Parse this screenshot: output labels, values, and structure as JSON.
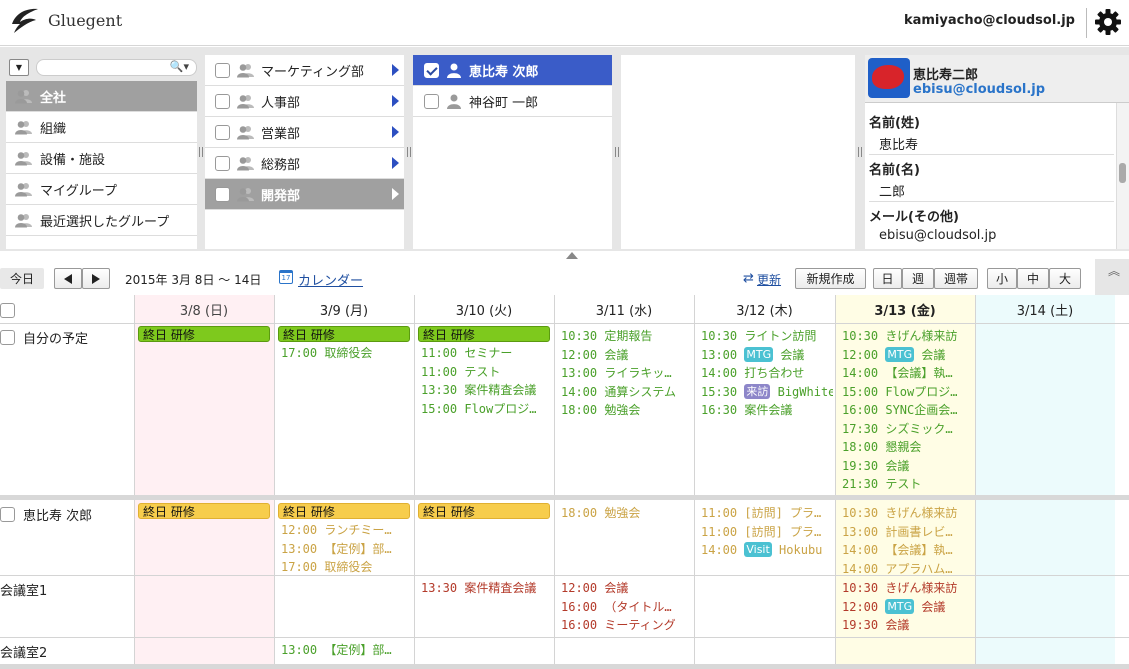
{
  "header": {
    "app_name": "Gluegent",
    "user_email": "kamiyacho@cloudsol.jp"
  },
  "pane1": {
    "dropdown_glyph": "▼",
    "search_placeholder": "",
    "search_icon": "🔍▾",
    "items": [
      {
        "label": "全社",
        "selected": true
      },
      {
        "label": "組織",
        "selected": false
      },
      {
        "label": "設備・施設",
        "selected": false
      },
      {
        "label": "マイグループ",
        "selected": false
      },
      {
        "label": "最近選択したグループ",
        "selected": false
      }
    ]
  },
  "pane2": {
    "items": [
      {
        "label": "マーケティング部",
        "selected": false
      },
      {
        "label": "人事部",
        "selected": false
      },
      {
        "label": "営業部",
        "selected": false
      },
      {
        "label": "総務部",
        "selected": false
      },
      {
        "label": "開発部",
        "selected": true
      }
    ]
  },
  "pane3": {
    "items": [
      {
        "label": "恵比寿 次郎",
        "selected": true,
        "checked": true
      },
      {
        "label": "神谷町 一郎",
        "selected": false,
        "checked": false
      }
    ]
  },
  "detail": {
    "name": "恵比寿二郎",
    "email": "ebisu@cloudsol.jp",
    "fields": [
      {
        "label": "名前(姓)",
        "value": "恵比寿"
      },
      {
        "label": "名前(名)",
        "value": "二郎"
      },
      {
        "label": "メール(その他)",
        "value": "ebisu@cloudsol.jp"
      }
    ]
  },
  "toolbar": {
    "today": "今日",
    "range": "2015年 3月 8日 〜 14日",
    "calendar_icon_text": "17",
    "calendar_link": "カレンダー",
    "refresh_icon": "⇄",
    "refresh": "更新",
    "new": "新規作成",
    "views": [
      "日",
      "週",
      "週帯"
    ],
    "sizes": [
      "小",
      "中",
      "大"
    ],
    "collapse_glyph": "︽"
  },
  "calendar": {
    "colors": {
      "sunday_bg": "#fff0f3",
      "today_bg": "#fffde5",
      "saturday_bg": "#ecfbfc",
      "event_green": "#4aa02a",
      "event_yellow": "#caa345",
      "event_red": "#b33a2a",
      "allday_green": "#7ec91d",
      "allday_yellow": "#f7cd4c"
    },
    "days": [
      {
        "label": "3/8 (日)",
        "type": "sun"
      },
      {
        "label": "3/9 (月)",
        "type": "weekday"
      },
      {
        "label": "3/10 (火)",
        "type": "weekday"
      },
      {
        "label": "3/11 (水)",
        "type": "weekday"
      },
      {
        "label": "3/12 (木)",
        "type": "weekday"
      },
      {
        "label": "3/13 (金)",
        "type": "today"
      },
      {
        "label": "3/14 (土)",
        "type": "sat"
      }
    ],
    "rows": [
      {
        "label": "自分の予定",
        "checkbox": true,
        "color": "green",
        "cells": [
          {
            "allday": "終日 研修",
            "events": []
          },
          {
            "allday": "終日 研修",
            "events": [
              {
                "time": "17:00",
                "title": "取締役会"
              }
            ]
          },
          {
            "allday": "終日 研修",
            "events": [
              {
                "time": "11:00",
                "title": "セミナー"
              },
              {
                "time": "11:00",
                "title": "テスト"
              },
              {
                "time": "13:30",
                "title": "案件精査会議"
              },
              {
                "time": "15:00",
                "title": "Flowプロジ…"
              }
            ]
          },
          {
            "allday": "",
            "events": [
              {
                "time": "10:30",
                "title": "定期報告"
              },
              {
                "time": "12:00",
                "title": "会議"
              },
              {
                "time": "13:00",
                "title": "ライラキッ…"
              },
              {
                "time": "14:00",
                "title": "通算システム"
              },
              {
                "time": "18:00",
                "title": "勉強会"
              }
            ]
          },
          {
            "allday": "",
            "events": [
              {
                "time": "10:30",
                "title": "ライトン訪問"
              },
              {
                "time": "13:00",
                "badge": "MTG",
                "badge_color": "teal",
                "title": "会議"
              },
              {
                "time": "14:00",
                "title": "打ち合わせ"
              },
              {
                "time": "15:30",
                "badge": "来訪",
                "badge_color": "purple",
                "title": "BigWhite"
              },
              {
                "time": "16:30",
                "title": "案件会議"
              }
            ]
          },
          {
            "allday": "",
            "events": [
              {
                "time": "10:30",
                "title": "きげん様来訪"
              },
              {
                "time": "12:00",
                "badge": "MTG",
                "badge_color": "teal",
                "title": "会議"
              },
              {
                "time": "14:00",
                "title": "【会議】執…"
              },
              {
                "time": "15:00",
                "title": "Flowプロジ…"
              },
              {
                "time": "16:00",
                "title": "SYNC企画会…"
              },
              {
                "time": "17:30",
                "title": "シズミック…"
              },
              {
                "time": "18:00",
                "title": "懇親会"
              },
              {
                "time": "19:30",
                "title": "会議"
              },
              {
                "time": "21:30",
                "title": "テスト"
              }
            ]
          },
          {
            "allday": "",
            "events": []
          }
        ]
      },
      {
        "label": "恵比寿 次郎",
        "checkbox": true,
        "color": "yellow",
        "cells": [
          {
            "allday": "終日 研修",
            "events": []
          },
          {
            "allday": "終日 研修",
            "events": [
              {
                "time": "12:00",
                "title": "ランチミー…"
              },
              {
                "time": "13:00",
                "title": "【定例】部…"
              },
              {
                "time": "17:00",
                "title": "取締役会"
              }
            ]
          },
          {
            "allday": "終日 研修",
            "events": []
          },
          {
            "allday": "",
            "events": [
              {
                "time": "18:00",
                "title": "勉強会"
              }
            ]
          },
          {
            "allday": "",
            "events": [
              {
                "time": "11:00",
                "title": "[訪問] プラ…"
              },
              {
                "time": "11:00",
                "title": "[訪問] プラ…"
              },
              {
                "time": "14:00",
                "badge": "Visit",
                "badge_color": "teal",
                "title": "Hokubu"
              }
            ]
          },
          {
            "allday": "",
            "events": [
              {
                "time": "10:30",
                "title": "きげん様来訪"
              },
              {
                "time": "13:00",
                "title": "計画書レビ…"
              },
              {
                "time": "14:00",
                "title": "【会議】執…"
              },
              {
                "time": "14:00",
                "title": "アプラハム…"
              }
            ]
          },
          {
            "allday": "",
            "events": []
          }
        ]
      },
      {
        "label": "会議室1",
        "checkbox": false,
        "color": "red",
        "cells": [
          {
            "allday": "",
            "events": []
          },
          {
            "allday": "",
            "events": []
          },
          {
            "allday": "",
            "events": [
              {
                "time": "13:30",
                "title": "案件精査会議"
              }
            ]
          },
          {
            "allday": "",
            "events": [
              {
                "time": "12:00",
                "title": "会議"
              },
              {
                "time": "16:00",
                "title": "（タイトル…"
              },
              {
                "time": "16:00",
                "title": "ミーティング"
              }
            ]
          },
          {
            "allday": "",
            "events": []
          },
          {
            "allday": "",
            "events": [
              {
                "time": "10:30",
                "title": "きげん様来訪"
              },
              {
                "time": "12:00",
                "badge": "MTG",
                "badge_color": "teal",
                "title": "会議"
              },
              {
                "time": "19:30",
                "title": "会議"
              }
            ]
          },
          {
            "allday": "",
            "events": []
          }
        ]
      },
      {
        "label": "会議室2",
        "checkbox": false,
        "color": "green",
        "cells": [
          {
            "allday": "",
            "events": []
          },
          {
            "allday": "",
            "events": [
              {
                "time": "13:00",
                "title": "【定例】部…"
              }
            ]
          },
          {
            "allday": "",
            "events": []
          },
          {
            "allday": "",
            "events": []
          },
          {
            "allday": "",
            "events": []
          },
          {
            "allday": "",
            "events": []
          },
          {
            "allday": "",
            "events": []
          }
        ]
      }
    ]
  }
}
